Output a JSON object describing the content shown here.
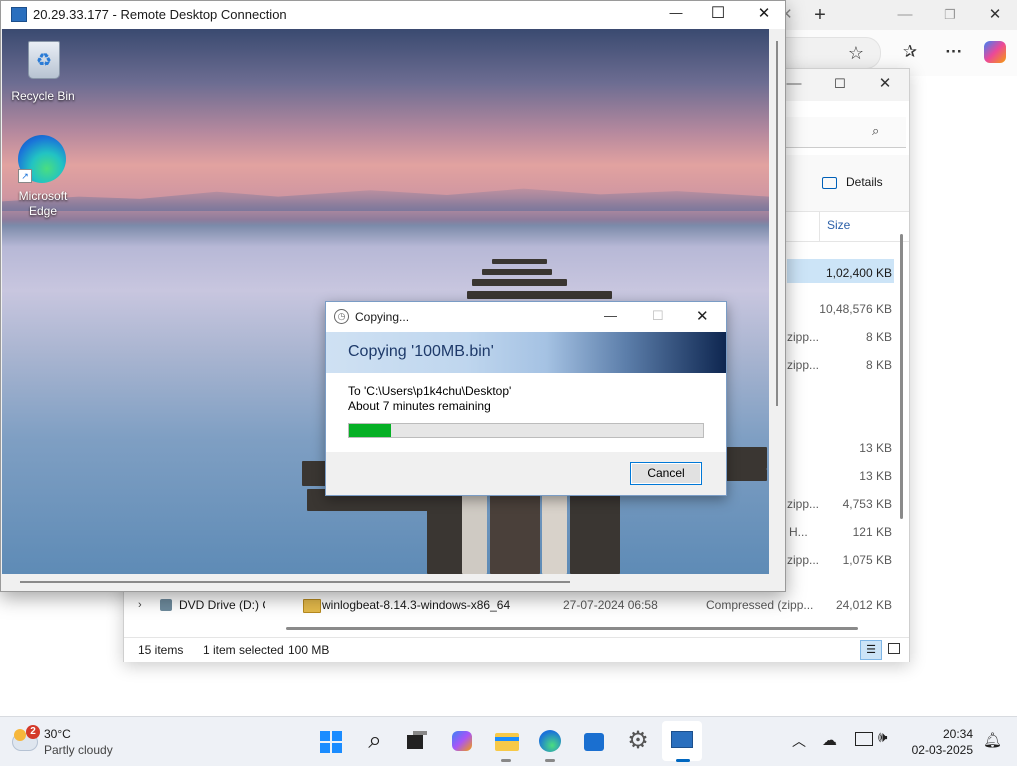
{
  "rdp": {
    "title": "20.29.33.177 - Remote Desktop Connection",
    "minimize": "—",
    "maximize": "☐",
    "close": "✕"
  },
  "desktop": {
    "icons": [
      {
        "label": "Recycle Bin",
        "icon": "recycle-bin-icon"
      },
      {
        "label": "Microsoft Edge",
        "icon": "edge-icon"
      }
    ]
  },
  "copy_dialog": {
    "title": "Copying...",
    "heading": "Copying '100MB.bin'",
    "destination": "To 'C:\\Users\\p1k4chu\\Desktop'",
    "remaining": "About 7 minutes remaining",
    "progress_fraction": 0.12,
    "cancel_label": "Cancel"
  },
  "explorer": {
    "details_label": "Details",
    "column_size": "Size",
    "rows": [
      {
        "type": "",
        "size": "1,02,400 KB",
        "selected": true
      },
      {
        "type": "",
        "size": "10,48,576 KB"
      },
      {
        "type": "zipp...",
        "size": "8 KB"
      },
      {
        "type": "zipp...",
        "size": "8 KB"
      },
      {
        "type": "",
        "size": "13 KB"
      },
      {
        "type": "",
        "size": "13 KB"
      },
      {
        "type": "zipp...",
        "size": "4,753 KB"
      },
      {
        "type": "H...",
        "size": "121 KB"
      },
      {
        "type": "zipp...",
        "size": "1,075 KB"
      }
    ],
    "last_row": {
      "name": "winlogbeat-8.14.3-windows-x86_64",
      "date": "27-07-2024 06:58",
      "type": "Compressed (zipp...",
      "size": "24,012 KB"
    },
    "nav_item": "DVD Drive (D:) C",
    "status_items": "15 items",
    "status_selected": "1 item selected",
    "status_size": "100 MB"
  },
  "taskbar": {
    "weather_badge": "2",
    "weather_temp": "30°C",
    "weather_desc": "Partly cloudy",
    "time": "20:34",
    "date": "02-03-2025"
  },
  "colors": {
    "accent": "#0078d4",
    "progress_green": "#06b025"
  }
}
